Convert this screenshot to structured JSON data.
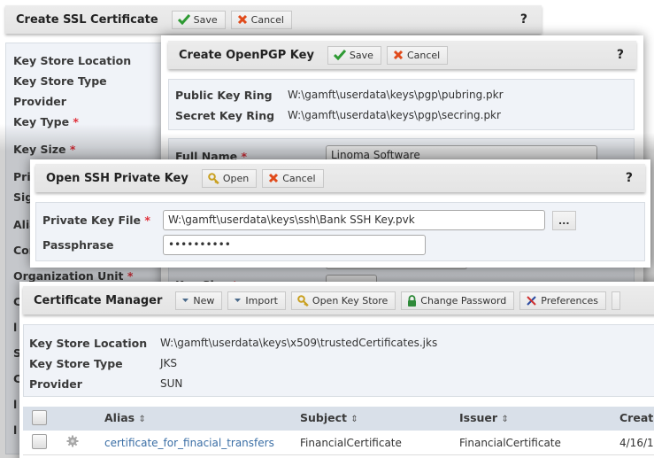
{
  "ssl_dialog": {
    "title": "Create SSL Certificate",
    "save_label": "Save",
    "cancel_label": "Cancel",
    "help_label": "?",
    "fields": [
      {
        "label": "Key Store Location",
        "required": false
      },
      {
        "label": "Key Store Type",
        "required": false
      },
      {
        "label": "Provider",
        "required": false
      },
      {
        "label": "Key Type",
        "required": true
      },
      {
        "label": "Key Size",
        "required": true
      },
      {
        "label": "Pri",
        "required": false
      },
      {
        "label": "Sig",
        "required": false
      },
      {
        "label": "Alia",
        "required": false
      },
      {
        "label": "Cor",
        "required": false
      },
      {
        "label": "Organization Unit",
        "required": true
      }
    ],
    "required_mark": "*"
  },
  "pgp_dialog": {
    "title": "Create OpenPGP Key",
    "save_label": "Save",
    "cancel_label": "Cancel",
    "help_label": "?",
    "public_key_ring_label": "Public Key Ring",
    "public_key_ring_value": "W:\\gamft\\userdata\\keys\\pgp\\pubring.pkr",
    "secret_key_ring_label": "Secret Key Ring",
    "secret_key_ring_value": "W:\\gamft\\userdata\\keys\\pgp\\secring.pkr",
    "full_name_label": "Full Name",
    "full_name_value": "Linoma Software",
    "key_size_label": "Key Size",
    "required_mark": "*"
  },
  "ssh_dialog": {
    "title": "Open SSH Private Key",
    "open_label": "Open",
    "cancel_label": "Cancel",
    "help_label": "?",
    "private_key_file_label": "Private Key File",
    "private_key_file_value": "W:\\gamft\\userdata\\keys\\ssh\\Bank SSH Key.pvk",
    "browse_label": "...",
    "passphrase_label": "Passphrase",
    "passphrase_value": "••••••••••",
    "required_mark": "*"
  },
  "cert_manager": {
    "title": "Certificate Manager",
    "toolbar": {
      "new_label": "New",
      "import_label": "Import",
      "open_key_store_label": "Open Key Store",
      "change_password_label": "Change Password",
      "preferences_label": "Preferences"
    },
    "info": {
      "key_store_location_label": "Key Store Location",
      "key_store_location_value": "W:\\gamft\\userdata\\keys\\x509\\trustedCertificates.jks",
      "key_store_type_label": "Key Store Type",
      "key_store_type_value": "JKS",
      "provider_label": "Provider",
      "provider_value": "SUN"
    },
    "table": {
      "columns": [
        "Alias",
        "Subject",
        "Issuer",
        "Creati"
      ],
      "sort_icon": "⇕",
      "rows": [
        {
          "alias": "certificate_for_finacial_transfers",
          "subject": "FinancialCertificate",
          "issuer": "FinancialCertificate",
          "created": "4/16/1"
        }
      ]
    }
  },
  "colors": {
    "required": "#e0303a",
    "link": "#3a6ea5",
    "panel_bg": "#f0f3f8",
    "header_bg": "#e8e8e8",
    "table_header_bg": "#d9e0e9"
  }
}
